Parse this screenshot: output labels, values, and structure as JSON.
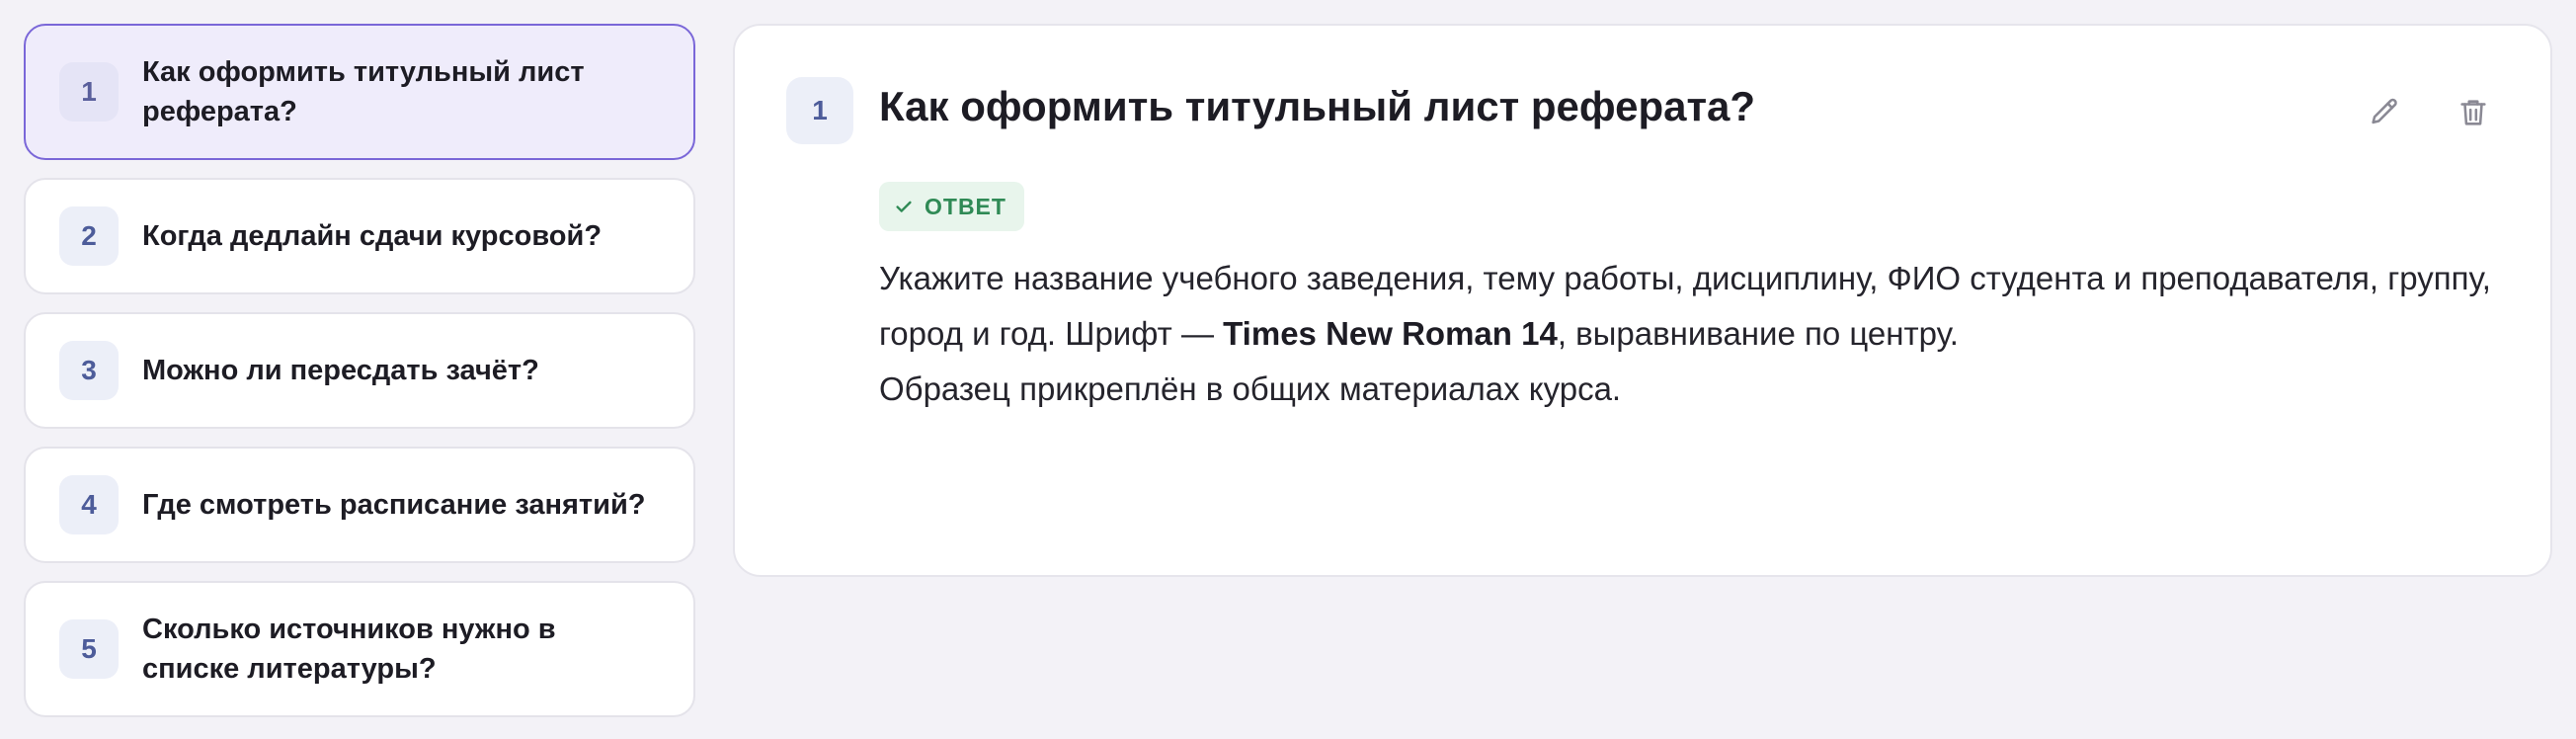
{
  "questions": [
    {
      "num": "1",
      "text": "Как оформить титульный лист реферата?",
      "active": true
    },
    {
      "num": "2",
      "text": "Когда дедлайн сдачи курсовой?",
      "active": false
    },
    {
      "num": "3",
      "text": "Можно ли пересдать зачёт?",
      "active": false
    },
    {
      "num": "4",
      "text": "Где смотреть расписание занятий?",
      "active": false
    },
    {
      "num": "5",
      "text": "Сколько источников нужно в списке литературы?",
      "active": false
    }
  ],
  "detail": {
    "num": "1",
    "title": "Как оформить титульный лист реферата?",
    "badge_label": "ОТВЕТ",
    "answer_part1": "Укажите название учебного заведения, тему работы, дисциплину, ФИО студента и преподавателя, группу, город и год. Шрифт — ",
    "answer_bold": "Times New Roman 14",
    "answer_part2": ", выравнивание по центру.",
    "answer_line2": "Образец прикреплён в общих материалах курса."
  },
  "icons": {
    "edit": "pencil-icon",
    "delete": "trash-icon",
    "badge": "check-icon"
  },
  "colors": {
    "accent": "#7a67d8",
    "active_bg": "#efecfb",
    "badge_green": "#2f8a55",
    "badge_bg": "#e8f5ec"
  }
}
